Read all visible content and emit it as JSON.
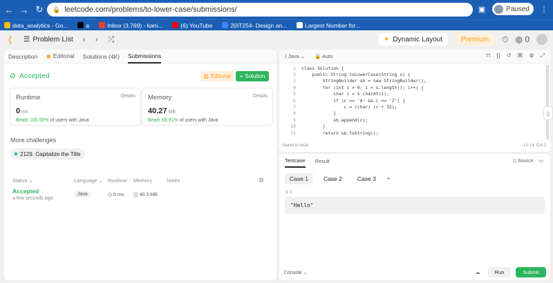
{
  "browser": {
    "url": "leetcode.com/problems/to-lower-case/submissions/",
    "profile_label": "Paused",
    "bookmarks": [
      {
        "label": "data_analytics - Go...",
        "color": "#fbbc04"
      },
      {
        "label": "a",
        "color": "#000000"
      },
      {
        "label": "Inbox (3,769) - kani...",
        "color": "#ea4335"
      },
      {
        "label": "(6) YouTube",
        "color": "#ff0000"
      },
      {
        "label": "20IT254- Design an...",
        "color": "#4285f4"
      },
      {
        "label": "Largest Number for...",
        "color": "#ffffff"
      }
    ]
  },
  "topbar": {
    "problem_list": "Problem List",
    "dynamic_layout": "Dynamic Layout",
    "premium": "Premium",
    "coin_count": "0"
  },
  "left": {
    "tabs": [
      "Description",
      "Editorial",
      "Solutions (4K)",
      "Submissions"
    ],
    "status": "Accepted",
    "editorial_btn": "Editorial",
    "solution_btn": "Solution",
    "runtime": {
      "title": "Runtime",
      "details": "Details",
      "value": "0",
      "unit": "ms",
      "beats_pct": "Beats 100.00%",
      "beats_rest": "of users with Java"
    },
    "memory": {
      "title": "Memory",
      "details": "Details",
      "value": "40.27",
      "unit": "MB",
      "beats_pct": "Beats 89.91%",
      "beats_rest": "of users with Java"
    },
    "more_challenges": "More challenges",
    "challenge": "2129. Capitalize the Title",
    "table_head": {
      "status": "Status",
      "language": "Language",
      "runtime": "Runtime",
      "memory": "Memory",
      "notes": "Notes"
    },
    "row": {
      "status": "Accepted",
      "time": "a few seconds ago",
      "language": "Java",
      "runtime": "0 ms",
      "memory": "40.3 MB"
    }
  },
  "editor": {
    "language": "Java",
    "mode": "Auto",
    "saved": "Saved to local",
    "position": "Ln 14, Col 2",
    "lines": [
      {
        "n": "1",
        "code": "class Solution {"
      },
      {
        "n": "2",
        "code": "    public String toLowerCase(String s) {"
      },
      {
        "n": "3",
        "code": "        StringBuilder sb = new StringBuilder();"
      },
      {
        "n": "4",
        "code": "        for (int i = 0; i < s.length(); i++) {"
      },
      {
        "n": "5",
        "code": "            char c = s.charAt(i);"
      },
      {
        "n": "6",
        "code": "            if (c >= 'A' && c <= 'Z') {"
      },
      {
        "n": "7",
        "code": "                c = (char) (c + 32);"
      },
      {
        "n": "8",
        "code": "            }"
      },
      {
        "n": "9",
        "code": "            sb.append(c);"
      },
      {
        "n": "10",
        "code": "        }"
      },
      {
        "n": "11",
        "code": "        return sb.toString();"
      }
    ]
  },
  "testcase": {
    "tabs": [
      "Testcase",
      "Result"
    ],
    "source": "Source",
    "cases": [
      "Case 1",
      "Case 2",
      "Case 3"
    ],
    "var_label": "s =",
    "var_value": "\"Hello\"",
    "console": "Console",
    "run": "Run",
    "submit": "Submit"
  },
  "colors": {
    "accent_green": "#2db55d",
    "accent_orange": "#ffa116",
    "chrome_blue": "#1a5fb4"
  }
}
